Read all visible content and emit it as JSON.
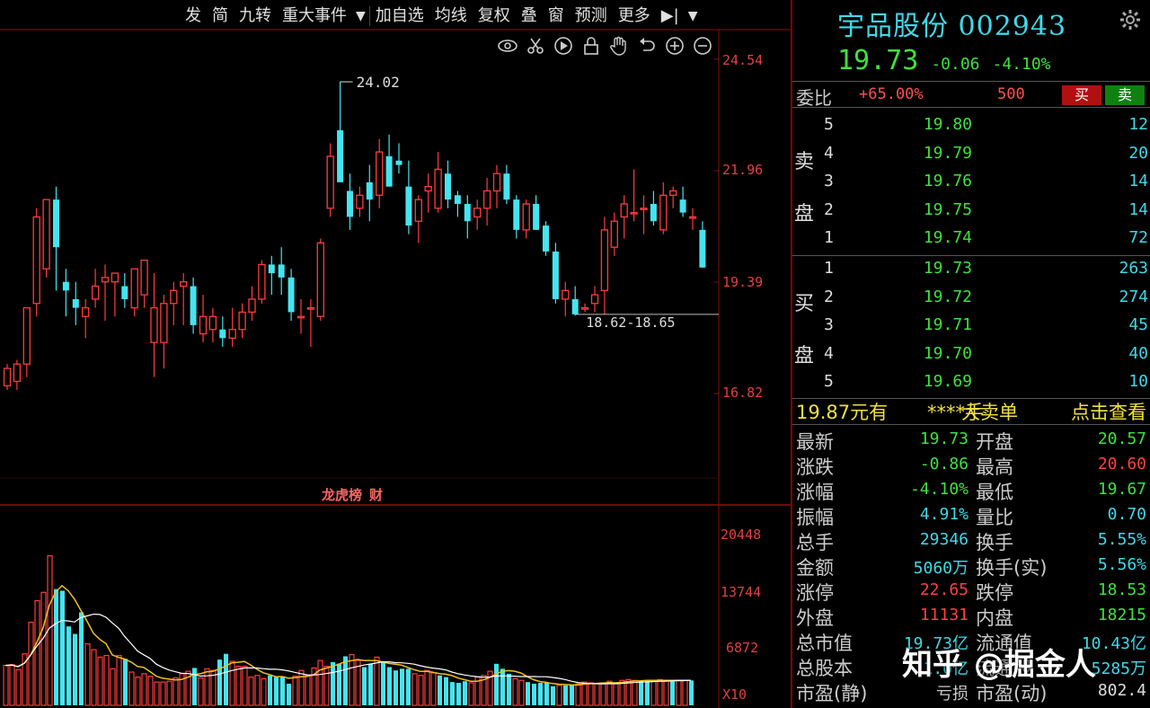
{
  "toolbar": {
    "items": [
      "发",
      "简",
      "九转",
      "重大事件",
      "加自选",
      "均线",
      "复权",
      "叠",
      "窗",
      "预测",
      "更多"
    ],
    "caret": "▼",
    "end_icon": "▶|"
  },
  "view_icons": [
    "eye-icon",
    "scissors-icon",
    "play-icon",
    "lock-icon",
    "hand-icon",
    "undo-icon",
    "zoom-in-icon",
    "zoom-out-icon"
  ],
  "price_axis": [
    "24.54",
    "21.96",
    "19.39",
    "16.82"
  ],
  "volume_axis": [
    "20448",
    "13744",
    "6872",
    "X10"
  ],
  "annotations": {
    "high": "24.02",
    "range": "18.62-18.65"
  },
  "mid_tabs": [
    "龙虎榜",
    "财"
  ],
  "chart_data": [
    {
      "type": "candlestick",
      "title": "",
      "ylim": [
        16.4,
        24.8
      ],
      "candles": [
        {
          "o": 17.0,
          "h": 17.5,
          "l": 16.9,
          "c": 17.4
        },
        {
          "o": 17.1,
          "h": 17.6,
          "l": 16.9,
          "c": 17.5
        },
        {
          "o": 17.5,
          "h": 18.8,
          "l": 17.2,
          "c": 18.8
        },
        {
          "o": 18.9,
          "h": 21.1,
          "l": 18.6,
          "c": 20.9
        },
        {
          "o": 19.7,
          "h": 21.3,
          "l": 19.5,
          "c": 21.3
        },
        {
          "o": 21.3,
          "h": 21.6,
          "l": 19.2,
          "c": 20.2
        },
        {
          "o": 19.4,
          "h": 19.7,
          "l": 18.6,
          "c": 19.2
        },
        {
          "o": 19.0,
          "h": 19.4,
          "l": 18.4,
          "c": 18.8
        },
        {
          "o": 18.6,
          "h": 19.0,
          "l": 18.1,
          "c": 18.8
        },
        {
          "o": 19.0,
          "h": 19.7,
          "l": 18.8,
          "c": 19.3
        },
        {
          "o": 19.4,
          "h": 19.8,
          "l": 18.5,
          "c": 19.5
        },
        {
          "o": 19.4,
          "h": 19.6,
          "l": 18.6,
          "c": 19.6
        },
        {
          "o": 19.3,
          "h": 19.6,
          "l": 18.8,
          "c": 19.0
        },
        {
          "o": 18.8,
          "h": 19.7,
          "l": 18.6,
          "c": 19.7
        },
        {
          "o": 19.1,
          "h": 19.8,
          "l": 18.8,
          "c": 19.9
        },
        {
          "o": 18.0,
          "h": 19.6,
          "l": 17.2,
          "c": 18.8
        },
        {
          "o": 18.0,
          "h": 19.1,
          "l": 17.4,
          "c": 18.9
        },
        {
          "o": 18.9,
          "h": 19.4,
          "l": 18.4,
          "c": 19.2
        },
        {
          "o": 19.3,
          "h": 19.6,
          "l": 18.4,
          "c": 19.4
        },
        {
          "o": 19.3,
          "h": 19.5,
          "l": 18.2,
          "c": 18.4
        },
        {
          "o": 18.2,
          "h": 19.1,
          "l": 18.0,
          "c": 18.6
        },
        {
          "o": 18.3,
          "h": 18.8,
          "l": 18.0,
          "c": 18.6
        },
        {
          "o": 18.3,
          "h": 18.6,
          "l": 17.9,
          "c": 18.1
        },
        {
          "o": 18.1,
          "h": 18.8,
          "l": 17.9,
          "c": 18.3
        },
        {
          "o": 18.3,
          "h": 18.9,
          "l": 18.1,
          "c": 18.7
        },
        {
          "o": 18.7,
          "h": 19.3,
          "l": 18.5,
          "c": 19.0
        },
        {
          "o": 19.0,
          "h": 19.9,
          "l": 18.9,
          "c": 19.8
        },
        {
          "o": 19.8,
          "h": 20.0,
          "l": 19.1,
          "c": 19.6
        },
        {
          "o": 19.8,
          "h": 20.2,
          "l": 19.1,
          "c": 19.5
        },
        {
          "o": 19.5,
          "h": 19.7,
          "l": 18.5,
          "c": 18.7
        },
        {
          "o": 18.6,
          "h": 19.0,
          "l": 18.2,
          "c": 18.6
        },
        {
          "o": 18.8,
          "h": 19.0,
          "l": 17.9,
          "c": 18.8
        },
        {
          "o": 18.6,
          "h": 20.4,
          "l": 18.5,
          "c": 20.3
        },
        {
          "o": 21.1,
          "h": 22.6,
          "l": 20.9,
          "c": 22.3
        },
        {
          "o": 22.9,
          "h": 24.02,
          "l": 21.7,
          "c": 21.7
        },
        {
          "o": 21.5,
          "h": 21.9,
          "l": 20.6,
          "c": 20.9
        },
        {
          "o": 21.1,
          "h": 21.6,
          "l": 20.9,
          "c": 21.4
        },
        {
          "o": 21.7,
          "h": 22.1,
          "l": 20.8,
          "c": 21.3
        },
        {
          "o": 21.4,
          "h": 22.7,
          "l": 21.1,
          "c": 22.4
        },
        {
          "o": 22.3,
          "h": 22.8,
          "l": 21.6,
          "c": 21.6
        },
        {
          "o": 22.2,
          "h": 22.6,
          "l": 21.9,
          "c": 22.1
        },
        {
          "o": 21.6,
          "h": 22.2,
          "l": 20.5,
          "c": 20.7
        },
        {
          "o": 20.8,
          "h": 21.4,
          "l": 20.3,
          "c": 21.3
        },
        {
          "o": 21.5,
          "h": 21.9,
          "l": 21.0,
          "c": 21.6
        },
        {
          "o": 21.1,
          "h": 22.4,
          "l": 21.0,
          "c": 22.0
        },
        {
          "o": 21.9,
          "h": 22.2,
          "l": 21.1,
          "c": 21.3
        },
        {
          "o": 21.4,
          "h": 21.5,
          "l": 20.9,
          "c": 21.2
        },
        {
          "o": 21.2,
          "h": 21.4,
          "l": 20.4,
          "c": 20.8
        },
        {
          "o": 20.9,
          "h": 21.3,
          "l": 20.6,
          "c": 21.1
        },
        {
          "o": 21.1,
          "h": 21.8,
          "l": 20.7,
          "c": 21.5
        },
        {
          "o": 21.5,
          "h": 22.1,
          "l": 21.1,
          "c": 21.9
        },
        {
          "o": 21.9,
          "h": 22.1,
          "l": 21.2,
          "c": 21.3
        },
        {
          "o": 21.3,
          "h": 21.4,
          "l": 20.4,
          "c": 20.6
        },
        {
          "o": 20.6,
          "h": 21.3,
          "l": 20.4,
          "c": 21.2
        },
        {
          "o": 21.2,
          "h": 21.4,
          "l": 20.6,
          "c": 20.6
        },
        {
          "o": 20.7,
          "h": 20.8,
          "l": 20.0,
          "c": 20.1
        },
        {
          "o": 20.1,
          "h": 20.3,
          "l": 18.9,
          "c": 19.0
        },
        {
          "o": 19.0,
          "h": 19.4,
          "l": 18.6,
          "c": 19.2
        },
        {
          "o": 19.0,
          "h": 19.3,
          "l": 18.62,
          "c": 18.65
        },
        {
          "o": 18.8,
          "h": 18.9,
          "l": 18.7,
          "c": 18.8
        },
        {
          "o": 18.9,
          "h": 19.3,
          "l": 18.7,
          "c": 19.1
        },
        {
          "o": 19.2,
          "h": 20.9,
          "l": 18.65,
          "c": 20.6
        },
        {
          "o": 20.2,
          "h": 21.0,
          "l": 20.0,
          "c": 20.8
        },
        {
          "o": 20.9,
          "h": 21.4,
          "l": 20.4,
          "c": 21.2
        },
        {
          "o": 21.0,
          "h": 22.0,
          "l": 20.8,
          "c": 21.0
        },
        {
          "o": 21.1,
          "h": 21.4,
          "l": 20.5,
          "c": 21.1
        },
        {
          "o": 21.2,
          "h": 21.5,
          "l": 20.7,
          "c": 20.8
        },
        {
          "o": 20.6,
          "h": 21.7,
          "l": 20.5,
          "c": 21.4
        },
        {
          "o": 21.4,
          "h": 21.6,
          "l": 21.1,
          "c": 21.5
        },
        {
          "o": 21.3,
          "h": 21.6,
          "l": 20.9,
          "c": 21.0
        },
        {
          "o": 20.9,
          "h": 21.1,
          "l": 20.6,
          "c": 20.9
        },
        {
          "o": 20.6,
          "h": 20.8,
          "l": 19.73,
          "c": 19.73
        }
      ]
    },
    {
      "type": "bar",
      "title": "",
      "ylim": [
        0,
        20448
      ],
      "values": [
        4800,
        4900,
        4300,
        6200,
        10000,
        12600,
        13600,
        18000,
        14000,
        13800,
        9500,
        8600,
        11200,
        7400,
        6700,
        5800,
        6000,
        4400,
        6000,
        5600,
        4000,
        3400,
        3800,
        3500,
        2800,
        2800,
        2900,
        3300,
        3800,
        4100,
        4500,
        3300,
        4400,
        4200,
        5500,
        6200,
        5300,
        4700,
        4700,
        3400,
        3600,
        3200,
        3600,
        3400,
        3500,
        2600,
        3500,
        4200,
        3600,
        4500,
        5400,
        4700,
        5200,
        5000,
        5900,
        6100,
        5400,
        4600,
        5000,
        5800,
        5200,
        4600,
        4200,
        4400,
        4400,
        3800,
        3600,
        4200,
        3900,
        3600,
        3400,
        2800,
        2700,
        2900,
        2700,
        3400,
        3600,
        4100,
        5000,
        4400,
        3800,
        3200,
        3000,
        2800,
        2600,
        2700,
        2700,
        2300,
        2400,
        2400,
        2500,
        2600,
        2800,
        2700,
        2600,
        2700,
        2900,
        2600,
        3000,
        3100,
        3000,
        3000,
        2900,
        3000,
        3100,
        3000,
        3000,
        3000,
        3000,
        3000
      ]
    }
  ],
  "stock": {
    "name": "宇品股份",
    "code": "002943",
    "price": "19.73",
    "change": "-0.06",
    "change_pct": "-4.10%"
  },
  "weibi": {
    "label": "委比",
    "pct": "+65.00%",
    "diff": "500",
    "buy": "买",
    "sell": "卖"
  },
  "sell_side": {
    "label_top": "卖",
    "label_bottom": "盘",
    "rows": [
      {
        "lvl": "5",
        "price": "19.80",
        "vol": "12"
      },
      {
        "lvl": "4",
        "price": "19.79",
        "vol": "20"
      },
      {
        "lvl": "3",
        "price": "19.76",
        "vol": "14"
      },
      {
        "lvl": "2",
        "price": "19.75",
        "vol": "14"
      },
      {
        "lvl": "1",
        "price": "19.74",
        "vol": "72"
      }
    ]
  },
  "buy_side": {
    "label_top": "买",
    "label_bottom": "盘",
    "rows": [
      {
        "lvl": "1",
        "price": "19.73",
        "vol": "263"
      },
      {
        "lvl": "2",
        "price": "19.72",
        "vol": "274"
      },
      {
        "lvl": "3",
        "price": "19.71",
        "vol": "45"
      },
      {
        "lvl": "4",
        "price": "19.70",
        "vol": "40"
      },
      {
        "lvl": "5",
        "price": "19.69",
        "vol": "10"
      }
    ]
  },
  "big_order": {
    "a": "19.87元有",
    "b": "****手",
    "c": "大卖单",
    "d": "点击查看"
  },
  "stats": [
    {
      "k1": "最新",
      "v1": "19.73",
      "c1": "#40e040",
      "k2": "开盘",
      "v2": "20.57",
      "c2": "#40e040"
    },
    {
      "k1": "涨跌",
      "v1": "-0.86",
      "c1": "#40e040",
      "k2": "最高",
      "v2": "20.60",
      "c2": "#ff4040"
    },
    {
      "k1": "涨幅",
      "v1": "-4.10%",
      "c1": "#40e040",
      "k2": "最低",
      "v2": "19.67",
      "c2": "#40e040"
    },
    {
      "k1": "振幅",
      "v1": "4.91%",
      "c1": "#40d8e8",
      "k2": "量比",
      "v2": "0.70",
      "c2": "#40d8e8"
    },
    {
      "k1": "总手",
      "v1": "29346",
      "c1": "#40d8e8",
      "k2": "换手",
      "v2": "5.55%",
      "c2": "#40d8e8"
    },
    {
      "k1": "金额",
      "v1": "5060万",
      "c1": "#40d8e8",
      "k2": "换手(实)",
      "v2": "5.56%",
      "c2": "#40d8e8"
    },
    {
      "k1": "涨停",
      "v1": "22.65",
      "c1": "#ff4040",
      "k2": "跌停",
      "v2": "18.53",
      "c2": "#40e040"
    },
    {
      "k1": "外盘",
      "v1": "11131",
      "c1": "#ff4040",
      "k2": "内盘",
      "v2": "18215",
      "c2": "#40e040"
    },
    {
      "k1": "总市值",
      "v1": "19.73亿",
      "c1": "#40d8e8",
      "k2": "流通值",
      "v2": "10.43亿",
      "c2": "#40d8e8"
    },
    {
      "k1": "总股本",
      "v1": "1.0亿",
      "c1": "#40d8e8",
      "k2": "流通股",
      "v2": "5285万",
      "c2": "#40d8e8"
    },
    {
      "k1": "市盈(静)",
      "v1": "亏损",
      "c1": "#ccc",
      "k2": "市盈(动)",
      "v2": "802.4",
      "c2": "#ddd"
    }
  ],
  "watermark": "知乎 @掘金人",
  "colors": {
    "up": "#ff3c3c",
    "down": "#44e4f0",
    "ma1": "#f0c020",
    "ma2": "#ffffff",
    "grid": "#8a1010"
  }
}
